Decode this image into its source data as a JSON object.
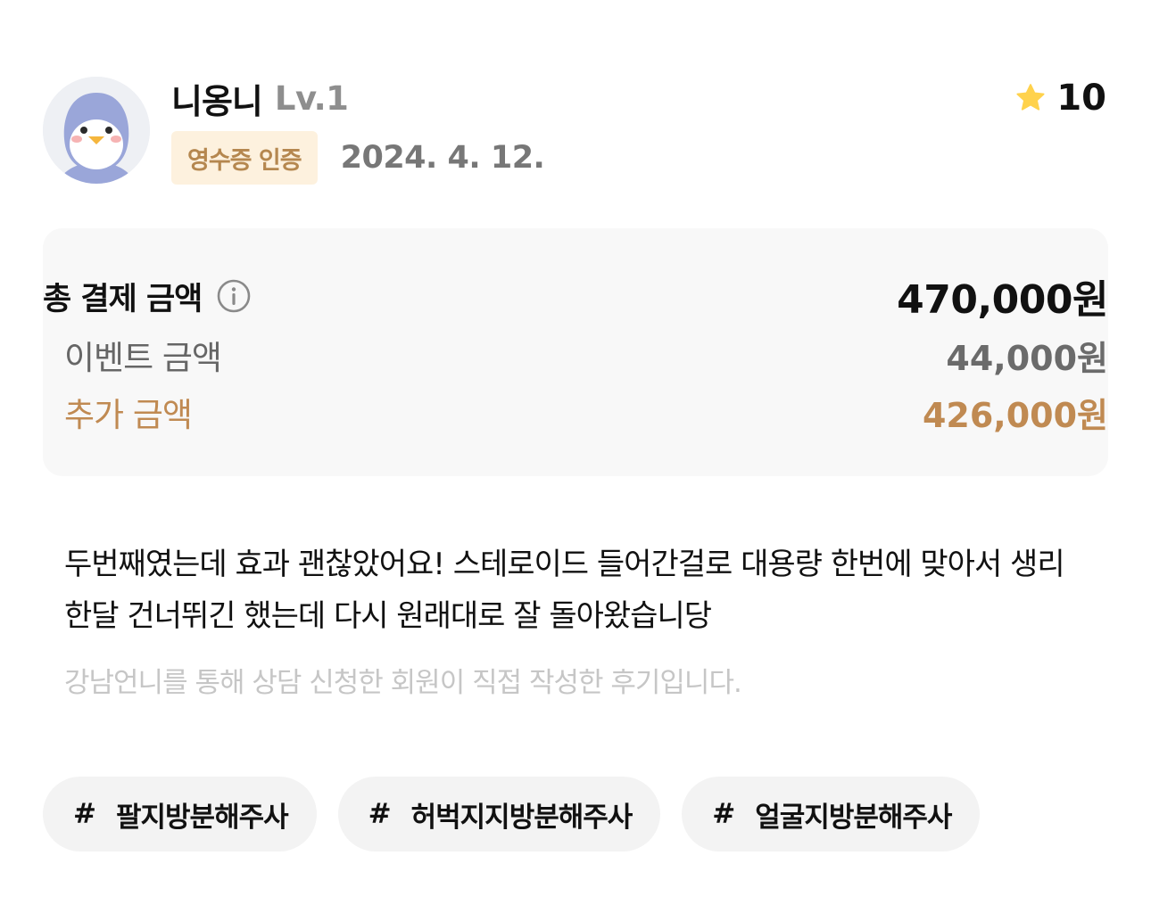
{
  "user": {
    "nickname": "니옹니",
    "level": "Lv.1",
    "avatar_icon": "penguin-avatar-icon"
  },
  "badge": {
    "label": "영수증 인증"
  },
  "date": "2024. 4. 12.",
  "rating": {
    "icon": "star-icon",
    "value": "10",
    "star_color": "#FFD24C"
  },
  "price": {
    "total_label": "총 결제 금액",
    "total_value": "470,000원",
    "info_icon": "info-icon",
    "event_label": "이벤트 금액",
    "event_value": "44,000원",
    "extra_label": "추가 금액",
    "extra_value": "426,000원"
  },
  "review": {
    "text": "두번째였는데 효과 괜찮았어요! 스테로이드 들어간걸로 대용량 한번에 맞아서 생리 한달 건너뛰긴 했는데 다시 원래대로 잘 돌아왔습니당",
    "disclaimer": "강남언니를 통해 상담 신청한 회원이 직접 작성한 후기입니다."
  },
  "tags": [
    {
      "hash": "#",
      "label": "팔지방분해주사"
    },
    {
      "hash": "#",
      "label": "허벅지지방분해주사"
    },
    {
      "hash": "#",
      "label": "얼굴지방분해주사"
    }
  ],
  "colors": {
    "accent": "#C08A52",
    "badge_bg": "#FDF1DE",
    "card_bg": "#F8F8F8",
    "tag_bg": "#F3F3F3"
  }
}
